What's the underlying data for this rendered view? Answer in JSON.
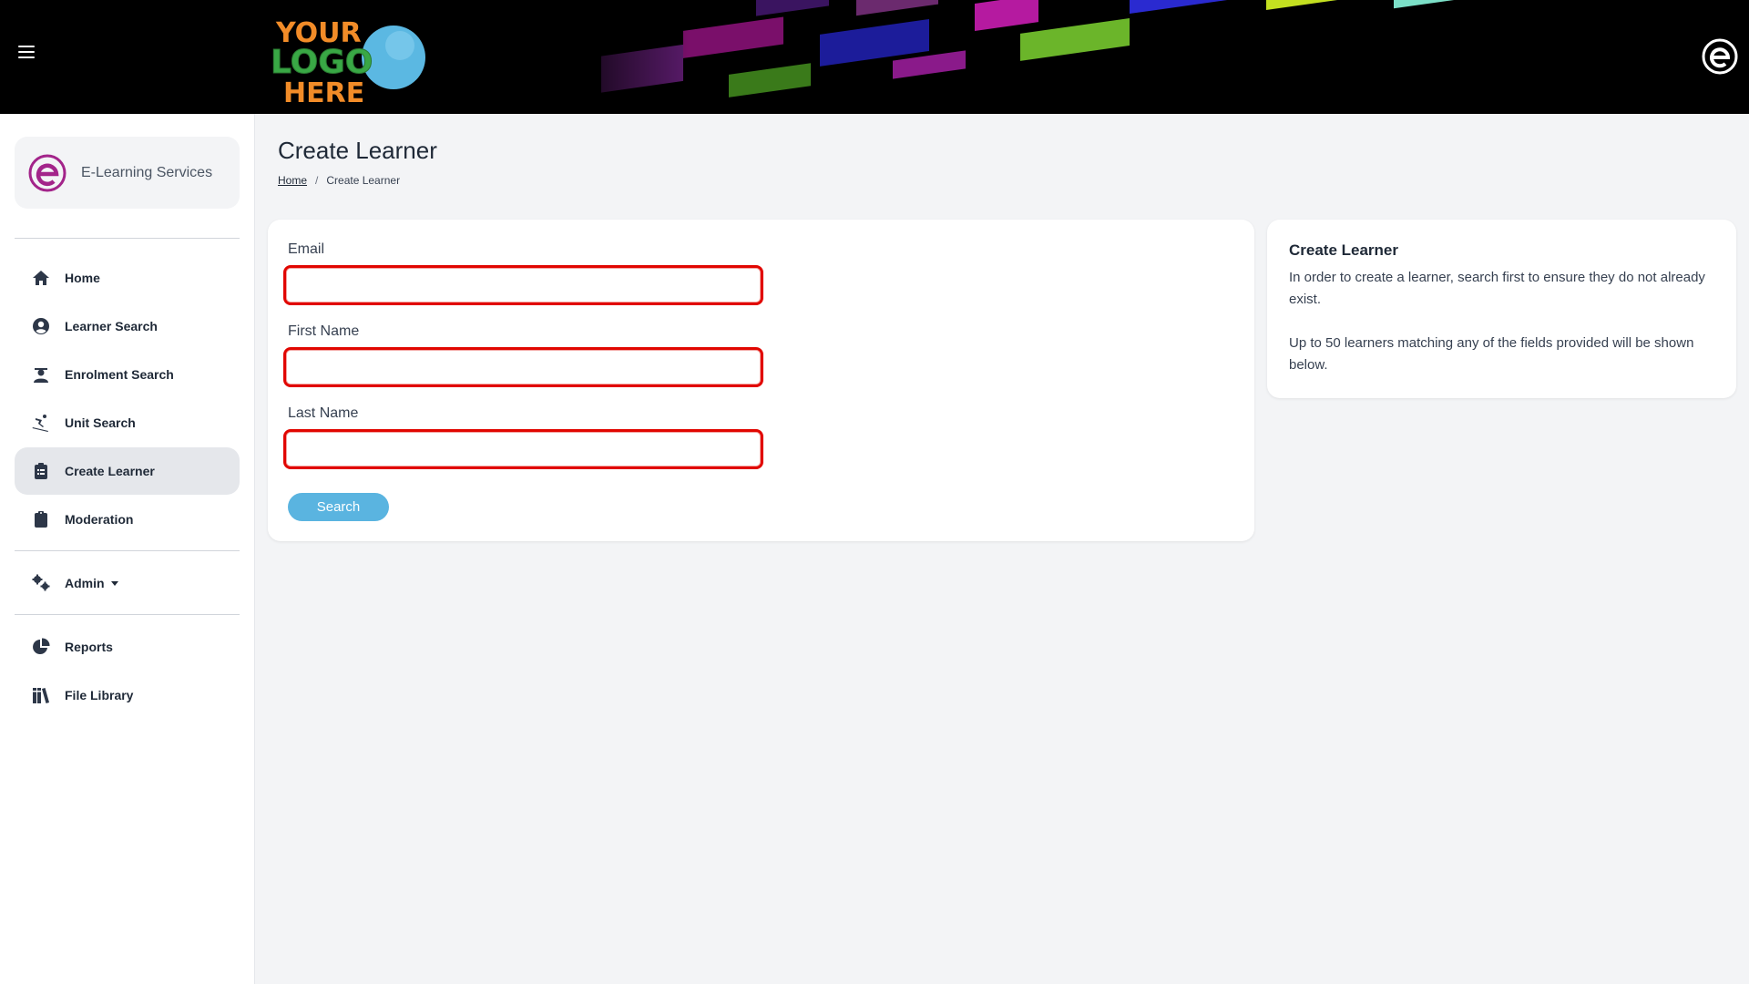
{
  "header": {
    "menu_icon": "hamburger-menu-icon",
    "logo_alt": "YOUR LOGO HERE",
    "brand_icon": "e-logo-icon"
  },
  "sidebar": {
    "brand": {
      "name": "E-Learning Services",
      "icon": "e-logo-icon"
    },
    "items": [
      {
        "label": "Home",
        "icon": "home-icon"
      },
      {
        "label": "Learner Search",
        "icon": "user-circle-icon"
      },
      {
        "label": "Enrolment Search",
        "icon": "graduate-icon"
      },
      {
        "label": "Unit Search",
        "icon": "skiing-icon"
      },
      {
        "label": "Create Learner",
        "icon": "clipboard-list-icon",
        "active": true
      },
      {
        "label": "Moderation",
        "icon": "clipboard-icon"
      },
      {
        "label": "Admin",
        "icon": "cogs-icon",
        "dropdown": true
      },
      {
        "label": "Reports",
        "icon": "pie-chart-icon"
      },
      {
        "label": "File Library",
        "icon": "book-library-icon"
      }
    ]
  },
  "main": {
    "title": "Create Learner",
    "breadcrumb": {
      "home": "Home",
      "separator": "/",
      "current": "Create Learner"
    },
    "form": {
      "email_label": "Email",
      "email_value": "",
      "first_name_label": "First Name",
      "first_name_value": "",
      "last_name_label": "Last Name",
      "last_name_value": "",
      "search_label": "Search"
    },
    "info": {
      "title": "Create Learner",
      "paragraph1": "In order to create a learner, search first to ensure they do not already exist.",
      "paragraph2": "Up to 50 learners matching any of the fields provided will be shown below."
    }
  },
  "colors": {
    "header_bg": "#000000",
    "invalid_border": "#e10600",
    "search_button": "#5ab4e0",
    "active_nav_bg": "#e5e7eb",
    "brand_magenta": "#a3248a"
  }
}
